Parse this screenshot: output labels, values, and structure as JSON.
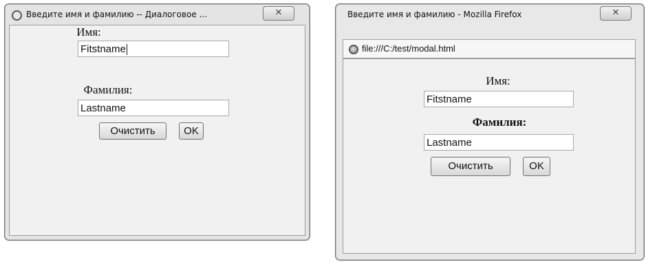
{
  "left_dialog": {
    "title": "Введите имя и фамилию -- Диалоговое ...",
    "close_glyph": "✕",
    "first_name_label": "Имя:",
    "first_name_value": "Fitstname",
    "last_name_label": "Фамилия:",
    "last_name_value": "Lastname",
    "clear_button": "Очистить",
    "ok_button": "OK"
  },
  "right_dialog": {
    "title": "Введите имя и фамилию - Mozilla Firefox",
    "close_glyph": "✕",
    "url": "file:///C:/test/modal.html",
    "first_name_label": "Имя:",
    "first_name_value": "Fitstname",
    "last_name_label": "Фамилия:",
    "last_name_value": "Lastname",
    "clear_button": "Очистить",
    "ok_button": "OK"
  }
}
